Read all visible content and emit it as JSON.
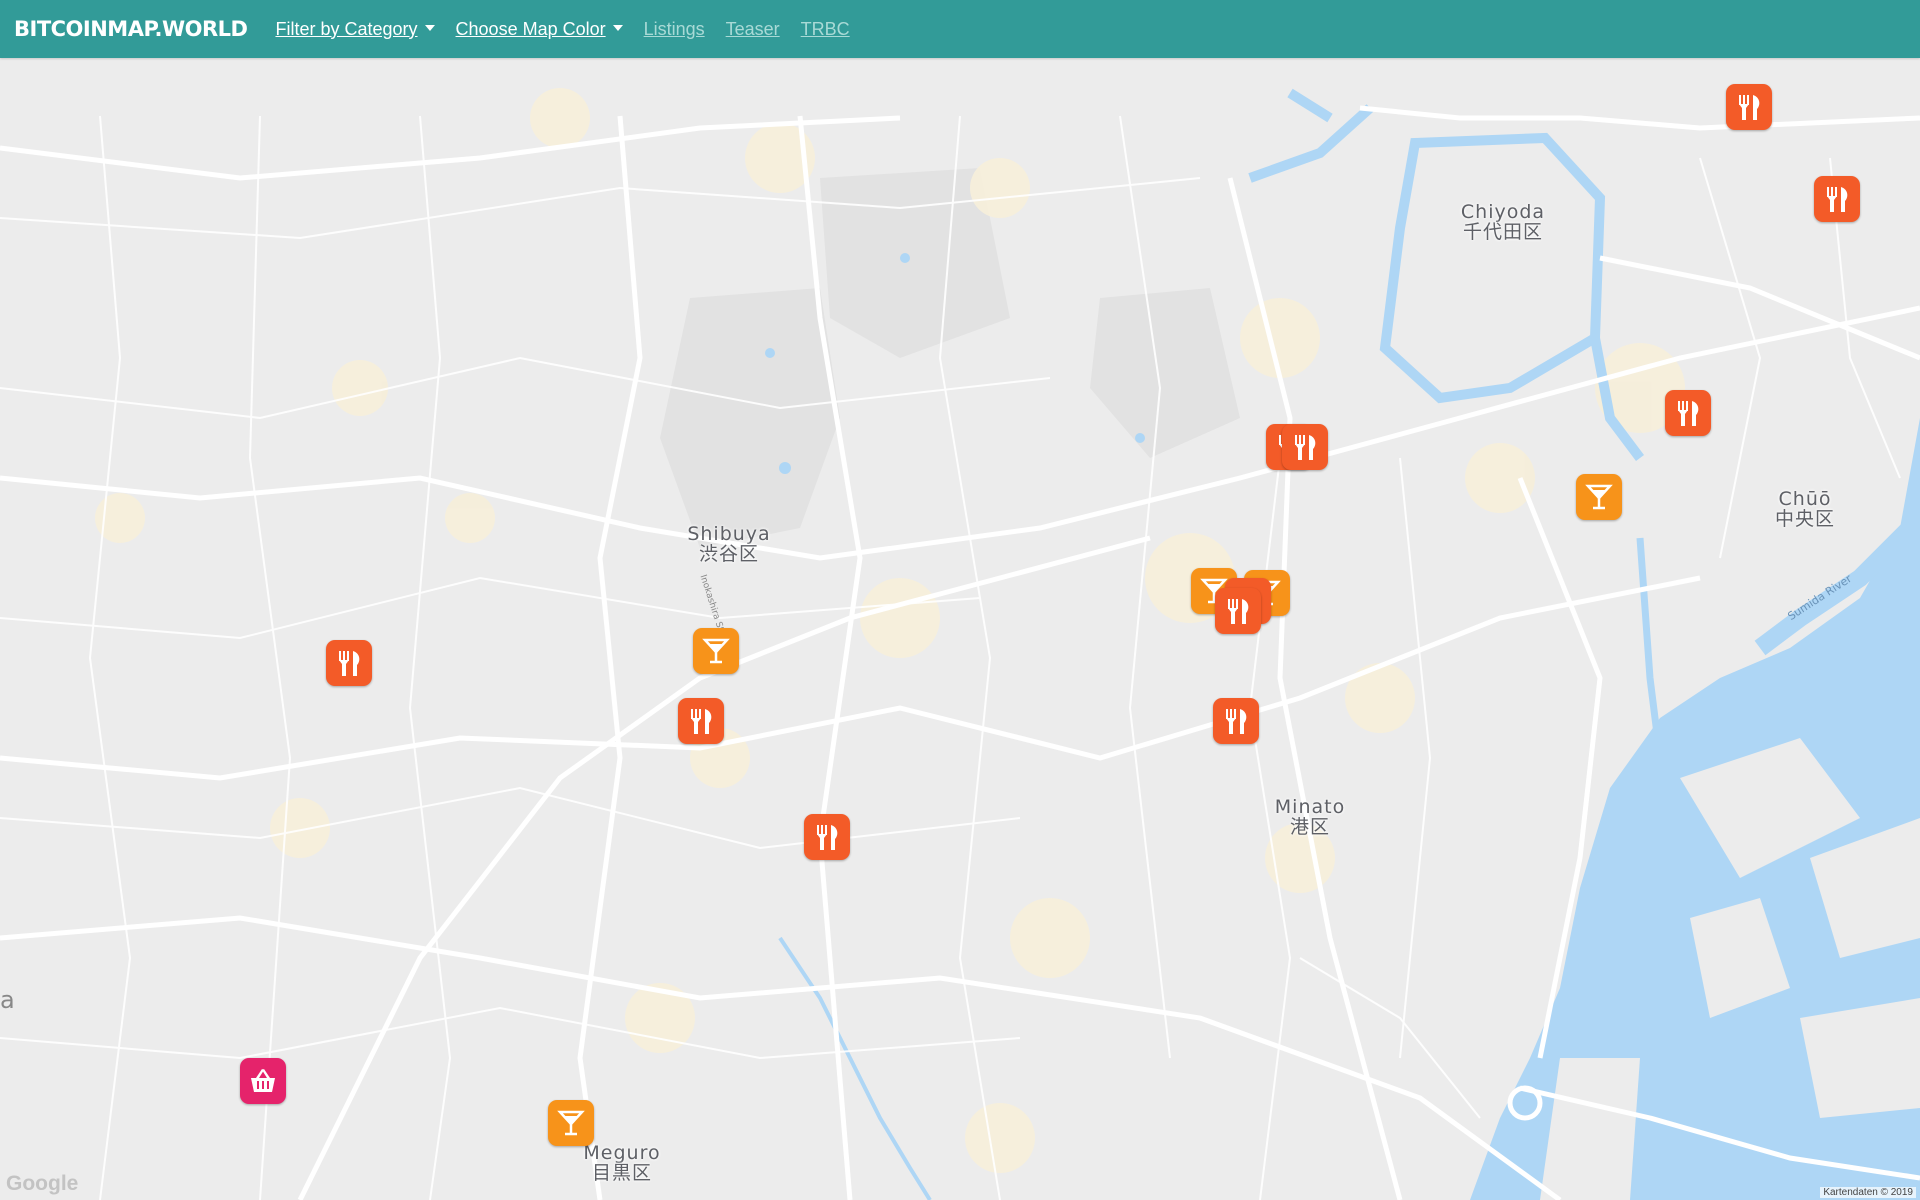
{
  "nav": {
    "brand": "BITCOINMAP.WORLD",
    "filter_label": "Filter by Category",
    "color_label": "Choose Map Color",
    "listings_label": "Listings",
    "teaser_label": "Teaser",
    "trbc_label": "TRBC"
  },
  "colors": {
    "navbar": "#329b98",
    "food_marker": "#f35b28",
    "bar_marker": "#f7931a",
    "shop_marker": "#e5236b",
    "water": "#aed6f5"
  },
  "map": {
    "labels": {
      "chiyoda_en": "Chiyoda",
      "chiyoda_jp": "千代田区",
      "chuo_en": "Chūō",
      "chuo_jp": "中央区",
      "shibuya_en": "Shibuya",
      "shibuya_jp": "渋谷区",
      "minato_en": "Minato",
      "minato_jp": "港区",
      "meguro_en": "Meguro",
      "meguro_jp": "目黒区",
      "edge_letter": "a",
      "river": "Sumida River",
      "road": "Inokashira St"
    },
    "google_logo": "Google",
    "attribution": "Kartendaten © 2019",
    "marker_icons": {
      "food": "fork-knife-icon",
      "bar": "cocktail-glass-icon",
      "shop": "shopping-basket-icon"
    }
  }
}
